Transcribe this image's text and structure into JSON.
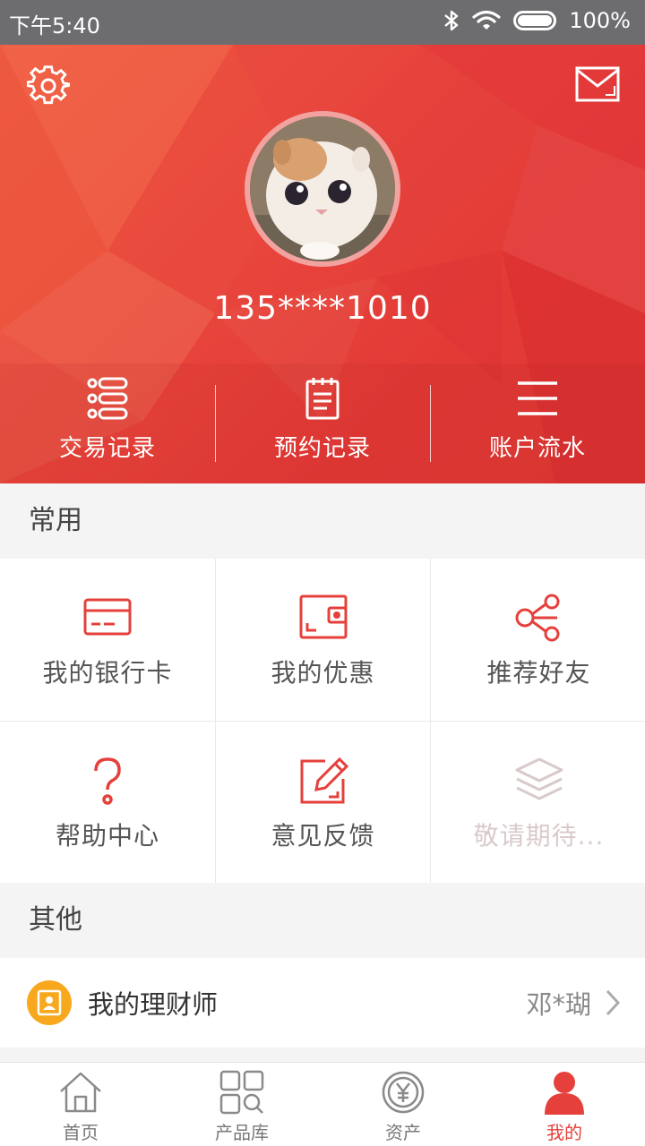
{
  "status_bar": {
    "time": "下午5:40",
    "battery": "100%",
    "icons": [
      "bluetooth-icon",
      "wifi-icon",
      "battery-icon"
    ]
  },
  "profile": {
    "phone": "135****1010",
    "avatar_icon": "cat-avatar",
    "settings_icon": "gear-icon",
    "message_icon": "mail-icon"
  },
  "quick_actions": [
    {
      "label": "交易记录",
      "icon": "list-dots-icon"
    },
    {
      "label": "预约记录",
      "icon": "notepad-icon"
    },
    {
      "label": "账户流水",
      "icon": "menu-lines-icon"
    }
  ],
  "common": {
    "title": "常用",
    "items": [
      {
        "label": "我的银行卡",
        "icon": "bank-card-icon"
      },
      {
        "label": "我的优惠",
        "icon": "wallet-icon"
      },
      {
        "label": "推荐好友",
        "icon": "share-icon"
      },
      {
        "label": "帮助中心",
        "icon": "question-icon"
      },
      {
        "label": "意见反馈",
        "icon": "edit-icon"
      },
      {
        "label": "敬请期待...",
        "icon": "layers-icon",
        "disabled": true
      }
    ]
  },
  "other": {
    "title": "其他",
    "advisor": {
      "label": "我的理财师",
      "value": "邓*瑚",
      "icon": "advisor-badge-icon"
    }
  },
  "tab_bar": {
    "active": "我的",
    "tabs": [
      {
        "label": "首页",
        "icon": "home-icon"
      },
      {
        "label": "产品库",
        "icon": "product-grid-icon"
      },
      {
        "label": "资产",
        "icon": "yuan-coin-icon"
      },
      {
        "label": "我的",
        "icon": "user-icon"
      }
    ]
  },
  "colors": {
    "brand_red": "#e5403b",
    "status_bar": "#6d6d70",
    "advisor_badge": "#f7a81c",
    "disabled_text": "#d9caca"
  }
}
